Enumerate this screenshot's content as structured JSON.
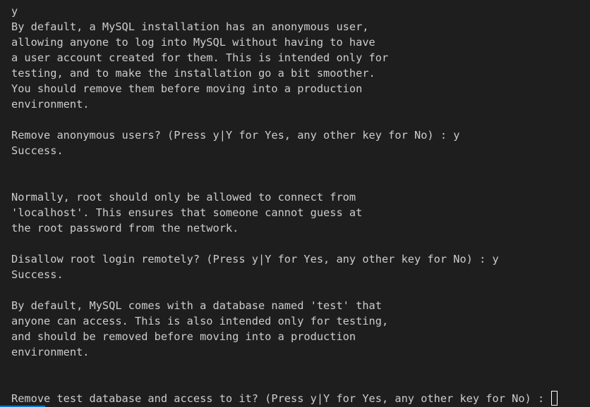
{
  "terminal": {
    "lines": [
      "y",
      "By default, a MySQL installation has an anonymous user,",
      "allowing anyone to log into MySQL without having to have",
      "a user account created for them. This is intended only for",
      "testing, and to make the installation go a bit smoother.",
      "You should remove them before moving into a production",
      "environment.",
      "",
      "Remove anonymous users? (Press y|Y for Yes, any other key for No) : y",
      "Success.",
      "",
      "",
      "Normally, root should only be allowed to connect from",
      "'localhost'. This ensures that someone cannot guess at",
      "the root password from the network.",
      "",
      "Disallow root login remotely? (Press y|Y for Yes, any other key for No) : y",
      "Success.",
      "",
      "By default, MySQL comes with a database named 'test' that",
      "anyone can access. This is also intended only for testing,",
      "and should be removed before moving into a production",
      "environment.",
      "",
      "",
      "Remove test database and access to it? (Press y|Y for Yes, any other key for No) : "
    ]
  },
  "colors": {
    "background": "#1e1e1e",
    "text": "#cccccc",
    "cursor": "#ffffff",
    "accent": "#0078d4"
  }
}
